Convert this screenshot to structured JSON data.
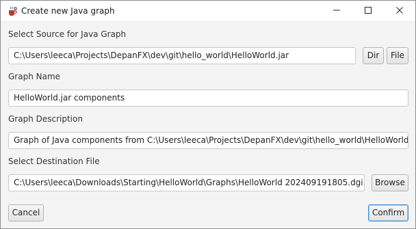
{
  "window": {
    "title": "Create new Java graph",
    "icon": "coffee-gear-icon",
    "controls": [
      "minimize-icon",
      "maximize-icon",
      "close-icon"
    ]
  },
  "source": {
    "label": "Select Source for Java Graph",
    "value": "C:\\Users\\leeca\\Projects\\DepanFX\\dev\\git\\hello_world\\HelloWorld.jar",
    "dir_button": "Dir",
    "file_button": "File"
  },
  "name": {
    "label": "Graph Name",
    "value": "HelloWorld.jar components"
  },
  "description": {
    "label": "Graph Description",
    "value": "Graph of Java components from C:\\Users\\leeca\\Projects\\DepanFX\\dev\\git\\hello_world\\HelloWorld.jar"
  },
  "destination": {
    "label": "Select Destination File",
    "value": "C:\\Users\\leeca\\Downloads\\Starting\\HelloWorld\\Graphs\\HelloWorld 202409191805.dgi",
    "browse_button": "Browse"
  },
  "actions": {
    "cancel": "Cancel",
    "confirm": "Confirm"
  },
  "colors": {
    "default_button_border": "#3a8fd9",
    "window_background": "#f4f4f4"
  }
}
